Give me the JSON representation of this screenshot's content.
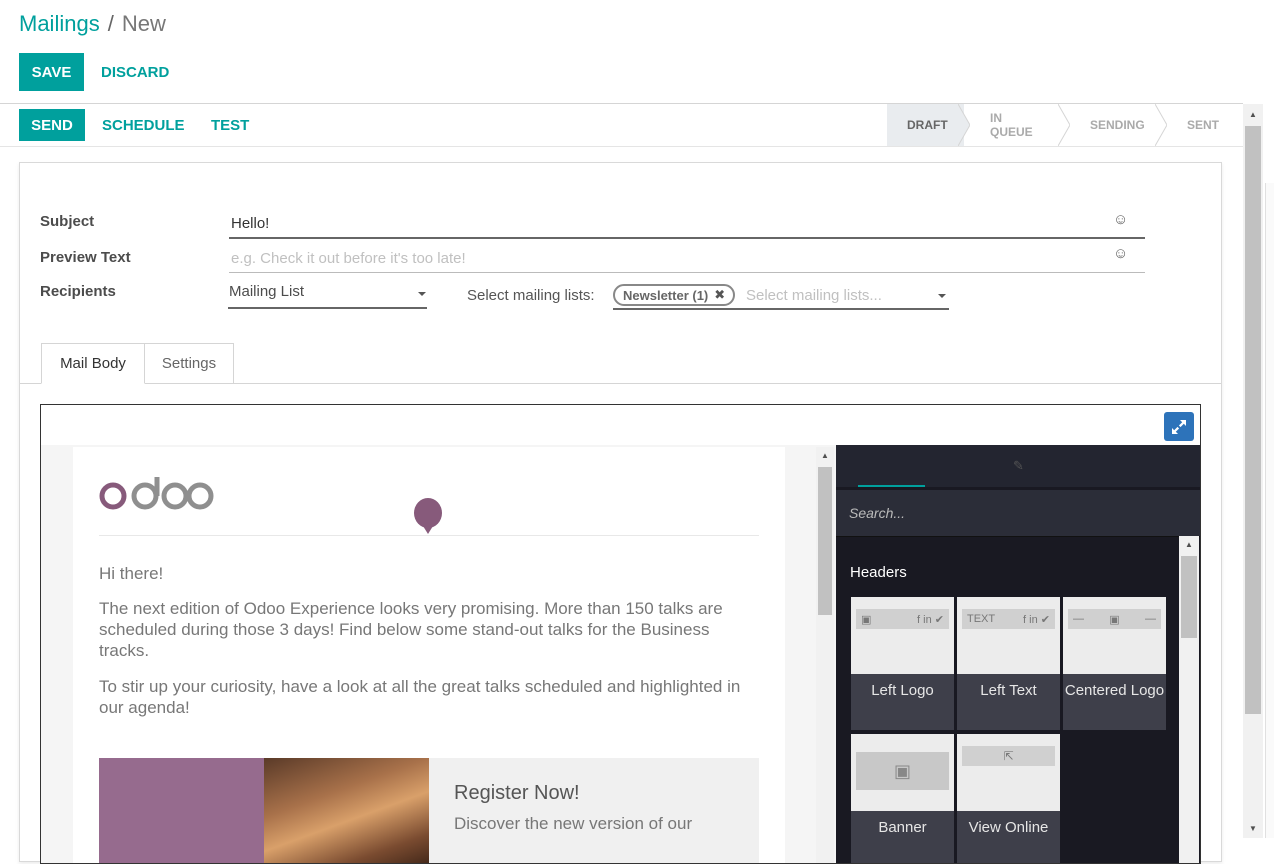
{
  "breadcrumb": {
    "parent": "Mailings",
    "separator": "/",
    "current": "New"
  },
  "control": {
    "save": "SAVE",
    "discard": "DISCARD"
  },
  "statusbar": {
    "send": "SEND",
    "schedule": "SCHEDULE",
    "test": "TEST",
    "stages": [
      "DRAFT",
      "IN QUEUE",
      "SENDING",
      "SENT"
    ],
    "active_stage": "DRAFT"
  },
  "form": {
    "subject_label": "Subject",
    "subject_value": "Hello!",
    "preview_label": "Preview Text",
    "preview_placeholder": "e.g. Check it out before it's too late!",
    "recipients_label": "Recipients",
    "recipients_value": "Mailing List",
    "lists_label": "Select mailing lists:",
    "lists_tag": "Newsletter (1)",
    "lists_placeholder": "Select mailing lists...",
    "emoji_icon": "smiley-icon"
  },
  "tabs": [
    "Mail Body",
    "Settings"
  ],
  "mail": {
    "logo": "odoo",
    "greeting": "Hi there!",
    "para1": "The next edition of Odoo Experience looks very promising. More than 150 talks are scheduled during those 3 days! Find below some stand-out talks for the Business tracks.",
    "para2": "To stir up your curiosity, have a look at all the great talks scheduled and highlighted in our agenda!",
    "register_title": "Register Now!",
    "register_text": "Discover the new version of our"
  },
  "snippets": {
    "search_placeholder": "Search...",
    "section": "Headers",
    "items": [
      "Left Logo",
      "Left Text",
      "Centered Logo",
      "Banner",
      "View Online"
    ],
    "left_text_mini": "TEXT"
  },
  "colors": {
    "accent": "#00A09D",
    "panel": "#191922",
    "brand_purple": "#875A7B"
  }
}
